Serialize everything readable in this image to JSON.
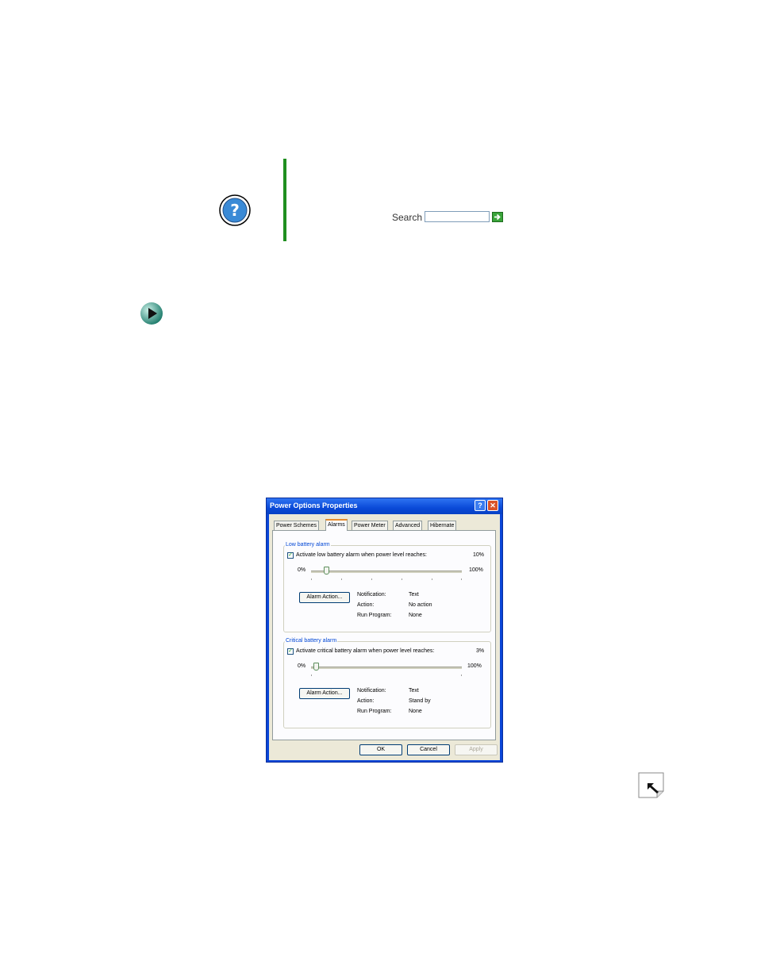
{
  "help_search": {
    "label": "Search",
    "input_value": ""
  },
  "dialog": {
    "title": "Power Options Properties",
    "tabs": [
      {
        "label": "Power Schemes",
        "selected": false
      },
      {
        "label": "Alarms",
        "selected": true
      },
      {
        "label": "Power Meter",
        "selected": false
      },
      {
        "label": "Advanced",
        "selected": false
      },
      {
        "label": "Hibernate",
        "selected": false
      }
    ],
    "low_battery": {
      "group_title": "Low battery alarm",
      "checkbox_label": "Activate low battery alarm when power level reaches:",
      "checked": true,
      "level_text": "10%",
      "level_value": 10,
      "min_label": "0%",
      "max_label": "100%",
      "alarm_button": "Alarm Action...",
      "notification_label": "Notification:",
      "notification_value": "Text",
      "action_label": "Action:",
      "action_value": "No action",
      "run_program_label": "Run Program:",
      "run_program_value": "None"
    },
    "critical_battery": {
      "group_title": "Critical battery alarm",
      "checkbox_label": "Activate critical battery alarm when power level reaches:",
      "checked": true,
      "level_text": "3%",
      "level_value": 3,
      "min_label": "0%",
      "max_label": "100%",
      "alarm_button": "Alarm Action...",
      "notification_label": "Notification:",
      "notification_value": "Text",
      "action_label": "Action:",
      "action_value": "Stand by",
      "run_program_label": "Run Program:",
      "run_program_value": "None"
    },
    "buttons": {
      "ok": "OK",
      "cancel": "Cancel",
      "apply": "Apply"
    }
  },
  "colors": {
    "accent_green": "#1f8f1f",
    "titlebar_blue": "#0a4ad8",
    "group_title_blue": "#0046d5"
  },
  "icons": [
    "help-question-icon",
    "search-go-arrow-icon",
    "play-arrow-icon",
    "page-corner-arrow-icon"
  ]
}
